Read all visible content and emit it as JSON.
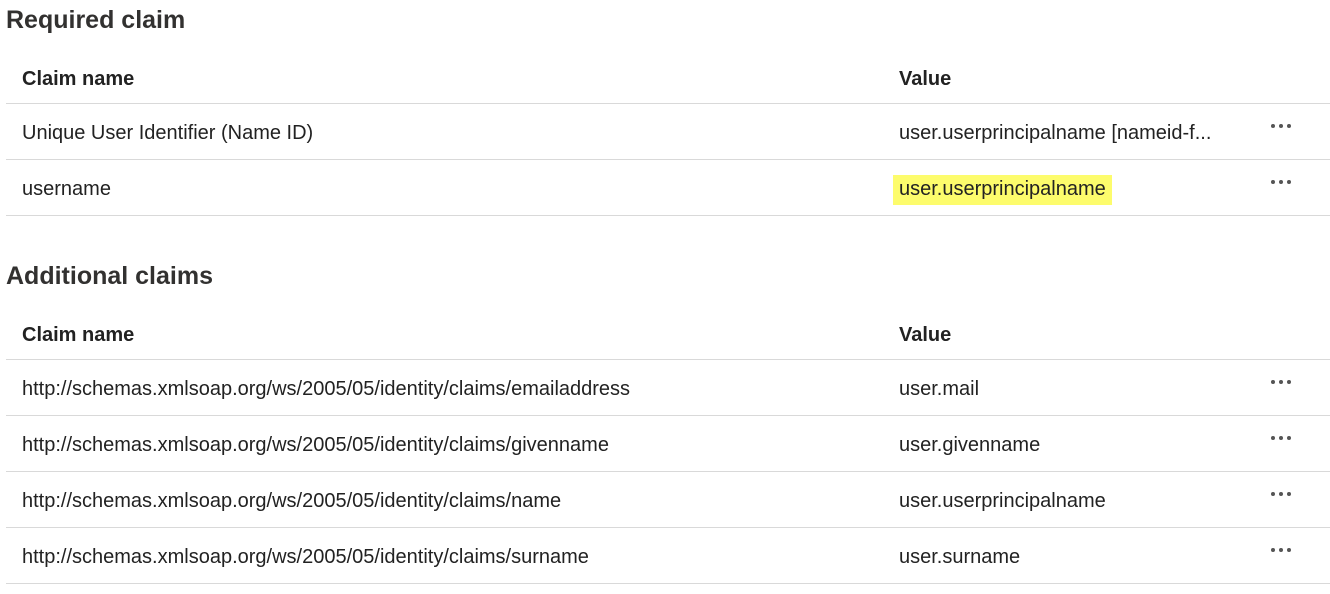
{
  "required": {
    "title": "Required claim",
    "headers": {
      "name": "Claim name",
      "value": "Value"
    },
    "rows": [
      {
        "name": "Unique User Identifier (Name ID)",
        "value": "user.userprincipalname [nameid-f...",
        "highlighted": false
      },
      {
        "name": "username",
        "value": "user.userprincipalname",
        "highlighted": true
      }
    ]
  },
  "additional": {
    "title": "Additional claims",
    "headers": {
      "name": "Claim name",
      "value": "Value"
    },
    "rows": [
      {
        "name": "http://schemas.xmlsoap.org/ws/2005/05/identity/claims/emailaddress",
        "value": "user.mail"
      },
      {
        "name": "http://schemas.xmlsoap.org/ws/2005/05/identity/claims/givenname",
        "value": "user.givenname"
      },
      {
        "name": "http://schemas.xmlsoap.org/ws/2005/05/identity/claims/name",
        "value": "user.userprincipalname"
      },
      {
        "name": "http://schemas.xmlsoap.org/ws/2005/05/identity/claims/surname",
        "value": "user.surname"
      }
    ]
  },
  "icons": {
    "row_menu": "more-horizontal-icon"
  },
  "colors": {
    "highlight": "#fdfc6c",
    "divider": "#d9d9d9"
  }
}
